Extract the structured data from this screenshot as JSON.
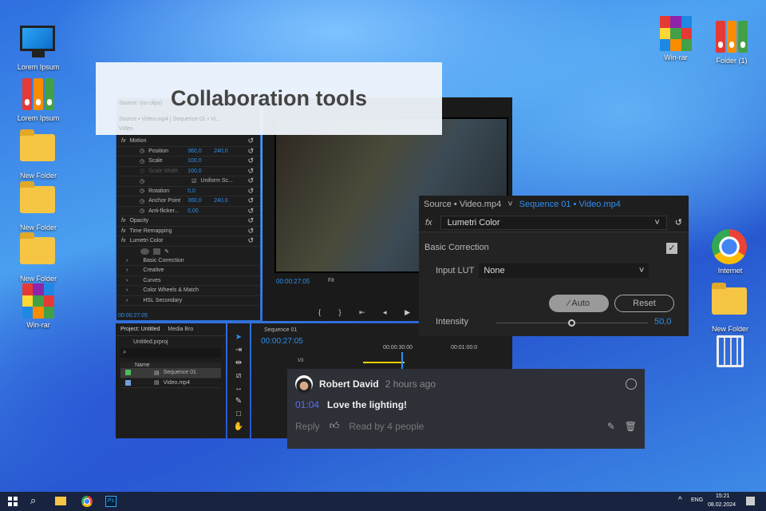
{
  "desktop_left": [
    {
      "label": "Lorem Ipsum",
      "icon": "computer-icon"
    },
    {
      "label": "Lorem Ipsum",
      "icon": "binders-icon"
    },
    {
      "label": "New Folder",
      "icon": "folder-icon"
    },
    {
      "label": "New Folder",
      "icon": "folder-icon"
    },
    {
      "label": "New Folder",
      "icon": "folder-icon"
    },
    {
      "label": "Win-rar",
      "icon": "winrar-icon"
    }
  ],
  "desktop_right": [
    {
      "label": "Win-rar",
      "icon": "winrar-icon"
    },
    {
      "label": "Folder (1)",
      "icon": "binders-icon"
    },
    {
      "label": "Internet",
      "icon": "chrome-icon"
    },
    {
      "label": "New Folder",
      "icon": "folder-icon"
    },
    {
      "label": "",
      "icon": "trash-icon"
    }
  ],
  "banner": {
    "title": "Collaboration tools"
  },
  "effects": {
    "faded_header": "Source: (no clips)",
    "faded_tabs": "Source • Video.mp4  |  Sequence 01 • Vi...",
    "faded_video": "Video",
    "rows": [
      {
        "label": "Motion",
        "fx": true
      },
      {
        "label": "Position",
        "v1": "360,0",
        "v2": "240,0"
      },
      {
        "label": "Scale",
        "v1": "100,0"
      },
      {
        "label": "Scale Width",
        "v1": "100,0",
        "disabled": true
      },
      {
        "label": "Uniform Sc...",
        "checkbox": true
      },
      {
        "label": "Rotation",
        "v1": "0,0"
      },
      {
        "label": "Anchor Point",
        "v1": "360,0",
        "v2": "240,0"
      },
      {
        "label": "Anti-flicker...",
        "v1": "0,00"
      },
      {
        "label": "Opacity",
        "fx": true
      },
      {
        "label": "Time Remapping",
        "fx": true
      },
      {
        "label": "Lumetri Color",
        "fx": true
      }
    ],
    "sub": [
      "Basic Correction",
      "Creative",
      "Curves",
      "Color Wheels & Match",
      "HSL Secondary"
    ],
    "timecode": "00:00:27:05"
  },
  "program": {
    "timecode": "00:00:27:05",
    "fit": "Fit"
  },
  "project": {
    "tab": "Project: Untitled",
    "tab2": "Media Bro",
    "file": "Untitled.prproj",
    "col": "Name",
    "items": [
      {
        "name": "Sequence 01",
        "color": "#4cbf5a"
      },
      {
        "name": "Video.mp4",
        "color": "#6fa0d8"
      }
    ]
  },
  "timeline": {
    "tab": "Sequence 01",
    "timecode": "00:00:27:05",
    "ticks": [
      "00:00:30:00",
      "00:01:00:0"
    ],
    "track": "V3"
  },
  "lumetri": {
    "source_tab": "Source • Video.mp4",
    "seq_tab": "Sequence 01 • Video.mp4",
    "effect": "Lumetri Color",
    "section": "Basic Correction",
    "lut_label": "Input LUT",
    "lut_value": "None",
    "auto": "Auto",
    "reset": "Reset",
    "intensity_label": "Intensity",
    "intensity_value": "50,0",
    "intensity_fraction": 0.5
  },
  "comment": {
    "author": "Robert David",
    "time": "2 hours ago",
    "timestamp": "01:04",
    "text": "Love the lighting!",
    "reply": "Reply",
    "read": "Read by 4 people"
  },
  "taskbar": {
    "lang": "ENG",
    "time": "15:21",
    "date": "08.02.2024"
  }
}
